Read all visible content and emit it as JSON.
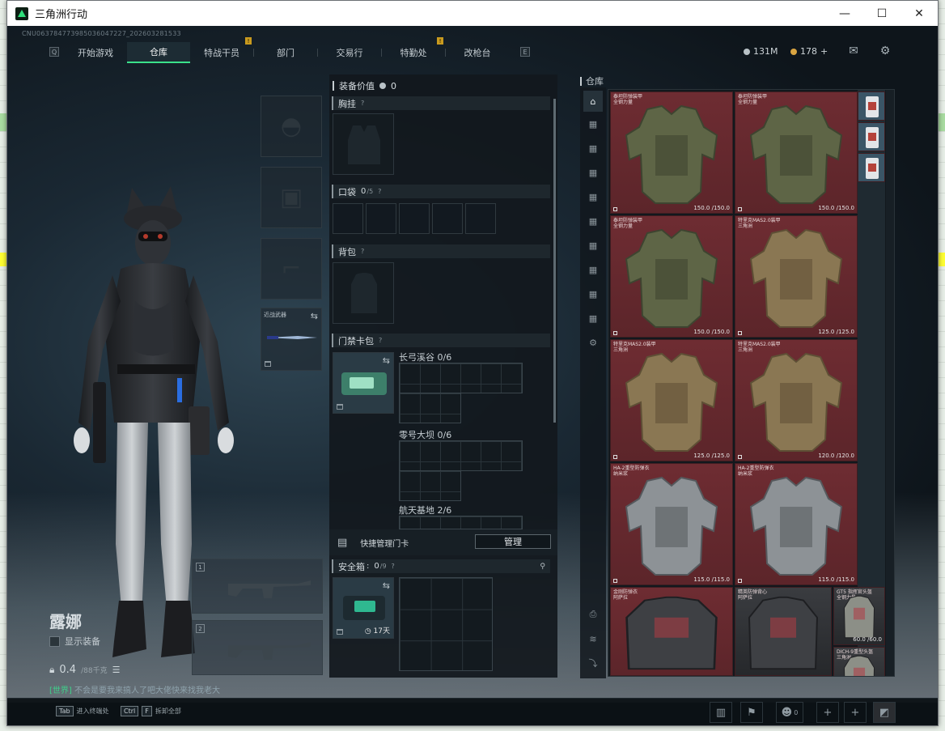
{
  "window": {
    "title": "三角洲行动"
  },
  "uid": "CNU063784773985036047227_202603281533",
  "nav": {
    "tabs": [
      {
        "label": "开始游戏",
        "active": false,
        "badge": ""
      },
      {
        "label": "仓库",
        "active": true,
        "badge": ""
      },
      {
        "label": "特战干员",
        "active": false,
        "badge": "!"
      },
      {
        "label": "部门",
        "active": false,
        "badge": ""
      },
      {
        "label": "交易行",
        "active": false,
        "badge": ""
      },
      {
        "label": "特勤处",
        "active": false,
        "badge": "!"
      },
      {
        "label": "改枪台",
        "active": false,
        "badge": ""
      }
    ],
    "left_key": "Q",
    "right_key": "E"
  },
  "currency": {
    "silver": "131M",
    "gold": "178"
  },
  "character": {
    "name": "露娜",
    "show_equip_label": "显示装备",
    "weight_value": "0.4",
    "weight_max": "/88千克"
  },
  "chat": {
    "channel": "[世界]",
    "message": "不会是要我来搞人了吧大佬快来找我老大"
  },
  "equip": {
    "melee_label": "近战武器",
    "weapon_slot_1": "1",
    "weapon_slot_2": "2"
  },
  "middle": {
    "value_label": "装备价值",
    "value": "0",
    "chest_rig_label": "胸挂",
    "pocket_label": "口袋",
    "pocket_count": "0",
    "pocket_max": "/5",
    "backpack_label": "背包",
    "keycard_label": "门禁卡包",
    "key_zones": [
      {
        "name": "长弓溪谷",
        "count": "0/6"
      },
      {
        "name": "零号大坝",
        "count": "0/6"
      },
      {
        "name": "航天基地",
        "count": "2/6"
      }
    ],
    "quick_manage_label": "快捷管理门卡",
    "manage_button": "管理",
    "safebox_label": "安全箱",
    "safebox_count": "0",
    "safebox_max": "/9",
    "safebox_days": "17天"
  },
  "storage": {
    "title": "仓库",
    "items": [
      {
        "name": "泰坦防弹装甲",
        "sub": "全钢力量",
        "durability": "150.0 /150.0",
        "color": "olive"
      },
      {
        "name": "泰坦防弹装甲",
        "sub": "全钢力量",
        "durability": "150.0 /150.0",
        "color": "olive"
      },
      {
        "name": "泰坦防弹装甲",
        "sub": "全钢力量",
        "durability": "150.0 /150.0",
        "color": "olive"
      },
      {
        "name": "特里克MAS2.0装甲",
        "sub": "三角洲",
        "durability": "125.0 /125.0",
        "color": "tan"
      },
      {
        "name": "特里克MAS2.0装甲",
        "sub": "三角洲",
        "durability": "125.0 /125.0",
        "color": "tan"
      },
      {
        "name": "特里克MAS2.0装甲",
        "sub": "三角洲",
        "durability": "120.0 /120.0",
        "color": "tan"
      },
      {
        "name": "HA-2重型防弹衣",
        "sub": "纳米浆",
        "durability": "115.0 /115.0",
        "color": "grey"
      },
      {
        "name": "HA-2重型防弹衣",
        "sub": "纳米浆",
        "durability": "115.0 /115.0",
        "color": "grey"
      },
      {
        "name": "金刚防弹衣",
        "sub": "阿萨拉",
        "durability": "",
        "color": "dark"
      },
      {
        "name": "精英防弹背心",
        "sub": "阿萨拉",
        "durability": "",
        "color": "dark"
      },
      {
        "name": "GT5 指挥官头盔",
        "sub": "全钢力量",
        "durability": "60.0 /60.0",
        "color": "helmet"
      },
      {
        "name": "DICH-9重型头盔",
        "sub": "三角洲",
        "durability": "",
        "color": "helmet"
      }
    ]
  },
  "bottom": {
    "hint1_key": "Tab",
    "hint1_text": "进入终端处",
    "hint2_key1": "Ctrl",
    "hint2_key2": "F",
    "hint2_text": "拆卸全部",
    "squad_count": "0"
  }
}
